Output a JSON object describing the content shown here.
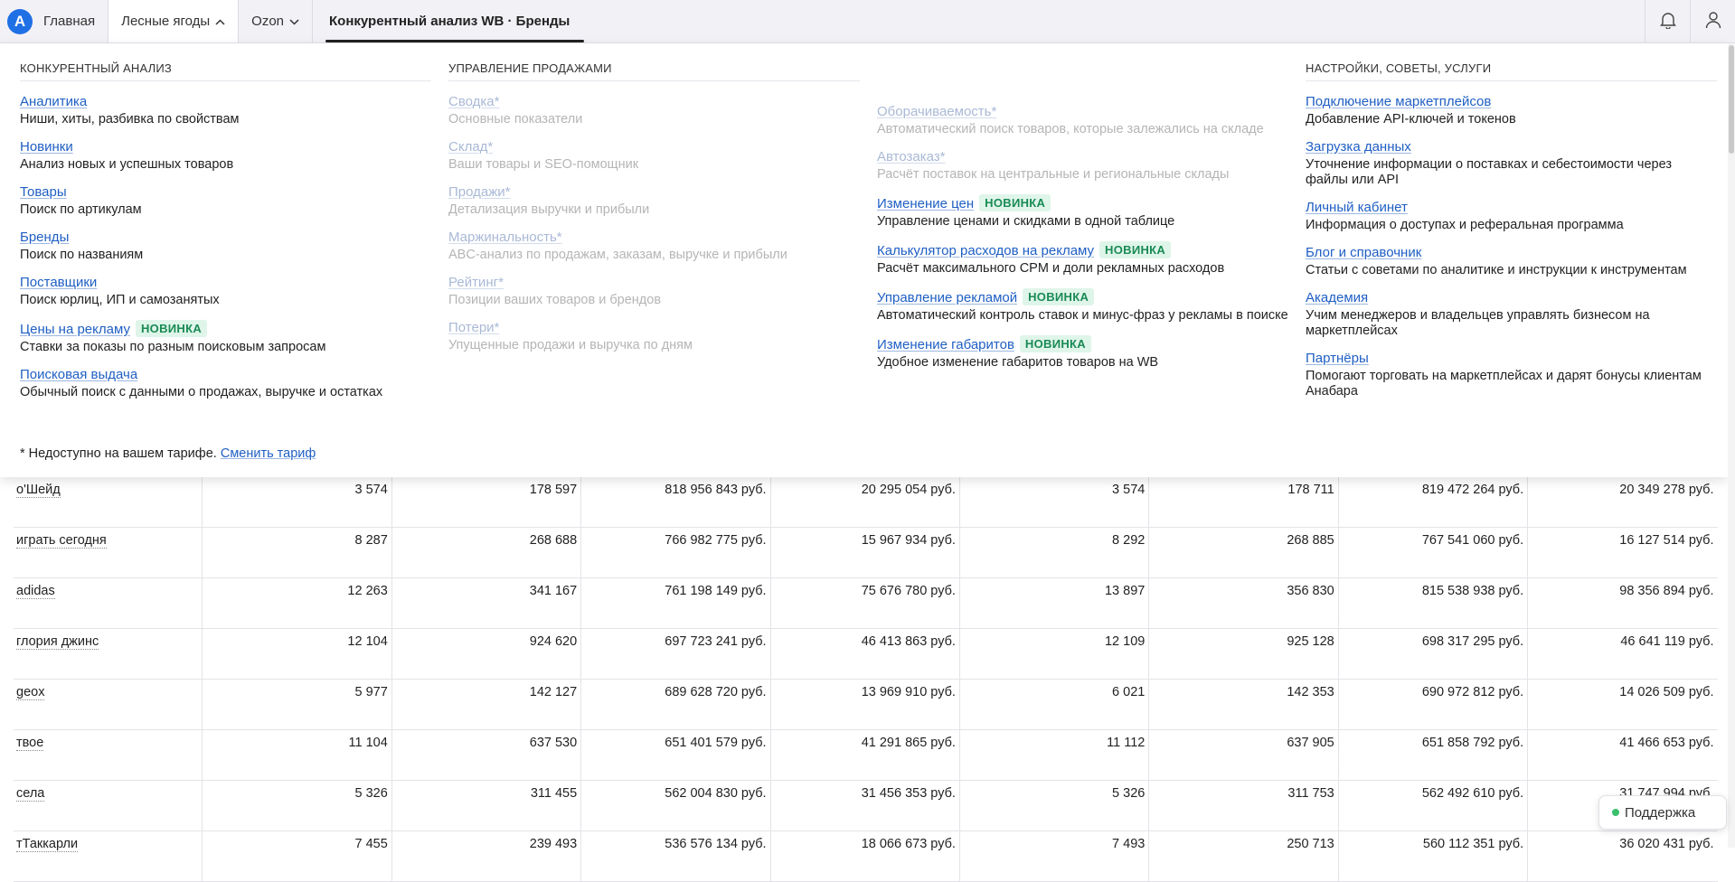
{
  "nav": {
    "logo": "A",
    "home": "Главная",
    "wb": "Лесные ягоды",
    "ozon": "Ozon",
    "current": "Конкурентный анализ WB · Бренды"
  },
  "menu": {
    "col1": {
      "title": "КОНКУРЕНТНЫЙ АНАЛИЗ",
      "items": [
        {
          "label": "Аналитика",
          "desc": "Ниши, хиты, разбивка по свойствам"
        },
        {
          "label": "Новинки",
          "desc": "Анализ новых и успешных товаров"
        },
        {
          "label": "Товары",
          "desc": "Поиск по артикулам"
        },
        {
          "label": "Бренды",
          "desc": "Поиск по названиям"
        },
        {
          "label": "Поставщики",
          "desc": "Поиск юрлиц, ИП и самозанятых"
        },
        {
          "label": "Цены на рекламу",
          "badge": "НОВИНКА",
          "desc": "Ставки за показы по разным поисковым запросам"
        },
        {
          "label": "Поисковая выдача",
          "desc": "Обычный поиск с данными о продажах, выручке и остатках"
        }
      ]
    },
    "col2": {
      "title": "УПРАВЛЕНИЕ ПРОДАЖАМИ",
      "items": [
        {
          "label": "Сводка*",
          "desc": "Основные показатели"
        },
        {
          "label": "Склад*",
          "desc": "Ваши товары и SEO-помощник"
        },
        {
          "label": "Продажи*",
          "desc": "Детализация выручки и прибыли"
        },
        {
          "label": "Маржинальность*",
          "desc": "ABC-анализ по продажам, заказам, выручке и прибыли"
        },
        {
          "label": "Рейтинг*",
          "desc": "Позиции ваших товаров и брендов"
        },
        {
          "label": "Потери*",
          "desc": "Упущенные продажи и выручка по дням"
        }
      ]
    },
    "col3": {
      "items": [
        {
          "label": "Оборачиваемость*",
          "desc": "Автоматический поиск товаров, которые залежались на складе"
        },
        {
          "label": "Автозаказ*",
          "desc": "Расчёт поставок на центральные и региональные склады"
        },
        {
          "label": "Изменение цен",
          "badge": "НОВИНКА",
          "desc": "Управление ценами и скидками в одной таблице"
        },
        {
          "label": "Калькулятор расходов на рекламу",
          "badge": "НОВИНКА",
          "desc": "Расчёт максимального CPM и доли рекламных расходов"
        },
        {
          "label": "Управление рекламой",
          "badge": "НОВИНКА",
          "desc": "Автоматический контроль ставок и минус-фраз у рекламы в поиске"
        },
        {
          "label": "Изменение габаритов",
          "badge": "НОВИНКА",
          "desc": "Удобное изменение габаритов товаров на WB"
        }
      ]
    },
    "col4": {
      "title": "НАСТРОЙКИ, СОВЕТЫ, УСЛУГИ",
      "items": [
        {
          "label": "Подключение маркетплейсов",
          "desc": "Добавление API-ключей и токенов"
        },
        {
          "label": "Загрузка данных",
          "desc": "Уточнение информации о поставках и себестоимости через файлы или API"
        },
        {
          "label": "Личный кабинет",
          "desc": "Информация о доступах и реферальная программа"
        },
        {
          "label": "Блог и справочник",
          "desc": "Статьи с советами по аналитике и инструкции к инструментам"
        },
        {
          "label": "Академия",
          "desc": "Учим менеджеров и владельцев управлять бизнесом на маркетплейсах"
        },
        {
          "label": "Партнёры",
          "desc": "Помогают торговать на маркетплейсах и дарят бонусы клиентам Анабара"
        }
      ]
    },
    "note": "* Недоступно на вашем тарифе.",
    "note_link": "Сменить тариф"
  },
  "table": {
    "rows": [
      [
        "о'Шейд",
        "3 574",
        "178 597",
        "818 956 843 руб.",
        "20 295 054 руб.",
        "3 574",
        "178 711",
        "819 472 264 руб.",
        "20 349 278 руб."
      ],
      [
        "играть сегодня",
        "8 287",
        "268 688",
        "766 982 775 руб.",
        "15 967 934 руб.",
        "8 292",
        "268 885",
        "767 541 060 руб.",
        "16 127 514 руб."
      ],
      [
        "adidas",
        "12 263",
        "341 167",
        "761 198 149 руб.",
        "75 676 780 руб.",
        "13 897",
        "356 830",
        "815 538 938 руб.",
        "98 356 894 руб."
      ],
      [
        "глория джинс",
        "12 104",
        "924 620",
        "697 723 241 руб.",
        "46 413 863 руб.",
        "12 109",
        "925 128",
        "698 317 295 руб.",
        "46 641 119 руб."
      ],
      [
        "geox",
        "5 977",
        "142 127",
        "689 628 720 руб.",
        "13 969 910 руб.",
        "6 021",
        "142 353",
        "690 972 812 руб.",
        "14 026 509 руб."
      ],
      [
        "твое",
        "11 104",
        "637 530",
        "651 401 579 руб.",
        "41 291 865 руб.",
        "11 112",
        "637 905",
        "651 858 792 руб.",
        "41 466 653 руб."
      ],
      [
        "села",
        "5 326",
        "311 455",
        "562 004 830 руб.",
        "31 456 353 руб.",
        "5 326",
        "311 753",
        "562 492 610 руб.",
        "31 747 994 руб."
      ],
      [
        "тТаккарли",
        "7 455",
        "239 493",
        "536 576 134 руб.",
        "18 066 673 руб.",
        "7 493",
        "250 713",
        "560 112 351 руб.",
        "36 020 431 руб."
      ]
    ]
  },
  "support": "Поддержка"
}
